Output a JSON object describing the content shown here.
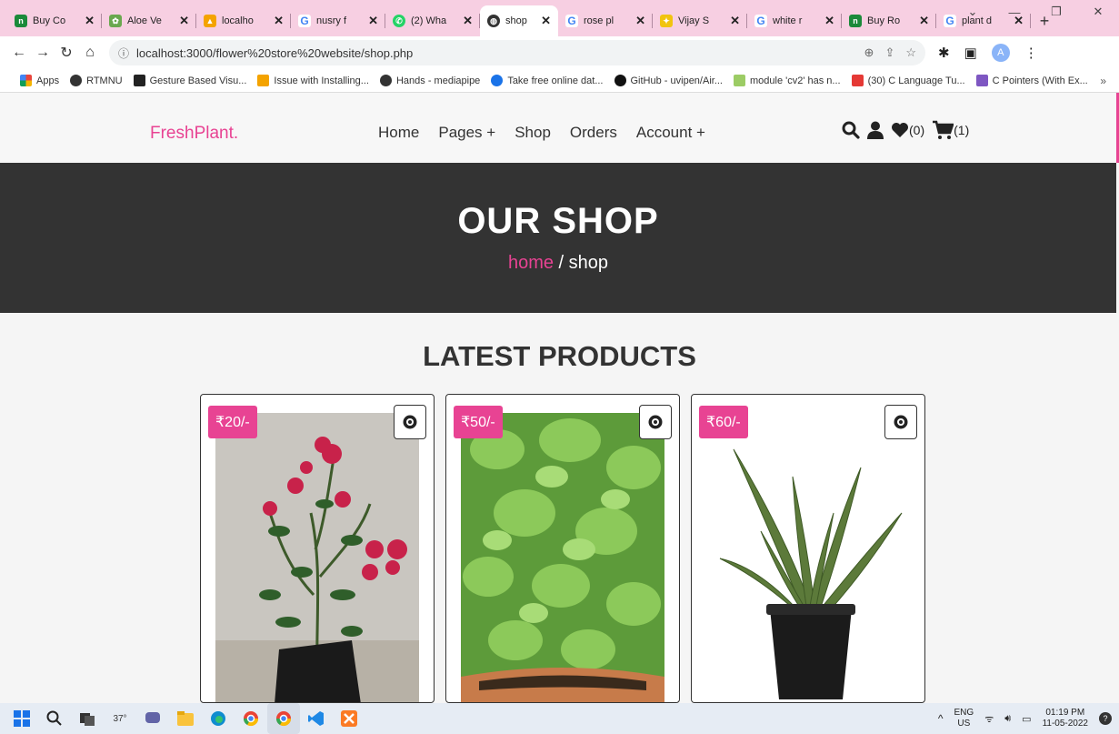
{
  "browser": {
    "tabs": [
      {
        "title": "Buy Co",
        "favicon": "nursery-live-icon",
        "color": "#1b8a3a"
      },
      {
        "title": "Aloe Ve",
        "favicon": "aloe-icon",
        "color": "#6aa84f"
      },
      {
        "title": "localho",
        "favicon": "xampp-icon",
        "color": "#f4a300"
      },
      {
        "title": "nusry f",
        "favicon": "google-icon",
        "color": "#4285f4"
      },
      {
        "title": "(2) Wha",
        "favicon": "whatsapp-icon",
        "color": "#25d366"
      },
      {
        "title": "shop",
        "favicon": "globe-icon",
        "color": "#333333",
        "active": true
      },
      {
        "title": "rose pl",
        "favicon": "google-icon",
        "color": "#4285f4"
      },
      {
        "title": "Vijay S",
        "favicon": "vijay-icon",
        "color": "#f1c40f"
      },
      {
        "title": "white r",
        "favicon": "google-icon",
        "color": "#4285f4"
      },
      {
        "title": "Buy Ro",
        "favicon": "nursery-live-icon",
        "color": "#1b8a3a"
      },
      {
        "title": "plant d",
        "favicon": "google-icon",
        "color": "#4285f4"
      }
    ],
    "url": "localhost:3000/flower%20store%20website/shop.php",
    "bookmarks": [
      {
        "label": "Apps",
        "color": "#e8453c"
      },
      {
        "label": "RTMNU",
        "color": "#333333"
      },
      {
        "label": "Gesture Based Visu...",
        "color": "#222222"
      },
      {
        "label": "Issue with Installing...",
        "color": "#f4a300"
      },
      {
        "label": "Hands - mediapipe",
        "color": "#333333"
      },
      {
        "label": "Take free online dat...",
        "color": "#1a73e8"
      },
      {
        "label": "GitHub - uvipen/Air...",
        "color": "#111111"
      },
      {
        "label": "module 'cv2' has n...",
        "color": "#9ccc65"
      },
      {
        "label": "(30) C Language Tu...",
        "color": "#e53935"
      },
      {
        "label": "C Pointers (With Ex...",
        "color": "#7e57c2"
      }
    ],
    "bookmarks_more": "»",
    "avatar_letter": "A"
  },
  "site": {
    "logo": "FreshPlant.",
    "nav": [
      "Home",
      "Pages +",
      "Shop",
      "Orders",
      "Account +"
    ],
    "wishlist_count": "(0)",
    "cart_count": "(1)",
    "accent": "#e84393"
  },
  "hero": {
    "title": "OUR SHOP",
    "crumb_home": "home",
    "crumb_sep": " / ",
    "crumb_current": "shop"
  },
  "products": {
    "title": "LATEST PRODUCTS",
    "items": [
      {
        "price": "₹20/-",
        "image": "rose-plant"
      },
      {
        "price": "₹50/-",
        "image": "mint-plant"
      },
      {
        "price": "₹60/-",
        "image": "aloe-vera-plant"
      }
    ]
  },
  "taskbar": {
    "weather": "37°",
    "lang_top": "ENG",
    "lang_bottom": "US",
    "time": "01:19 PM",
    "date": "11-05-2022"
  }
}
